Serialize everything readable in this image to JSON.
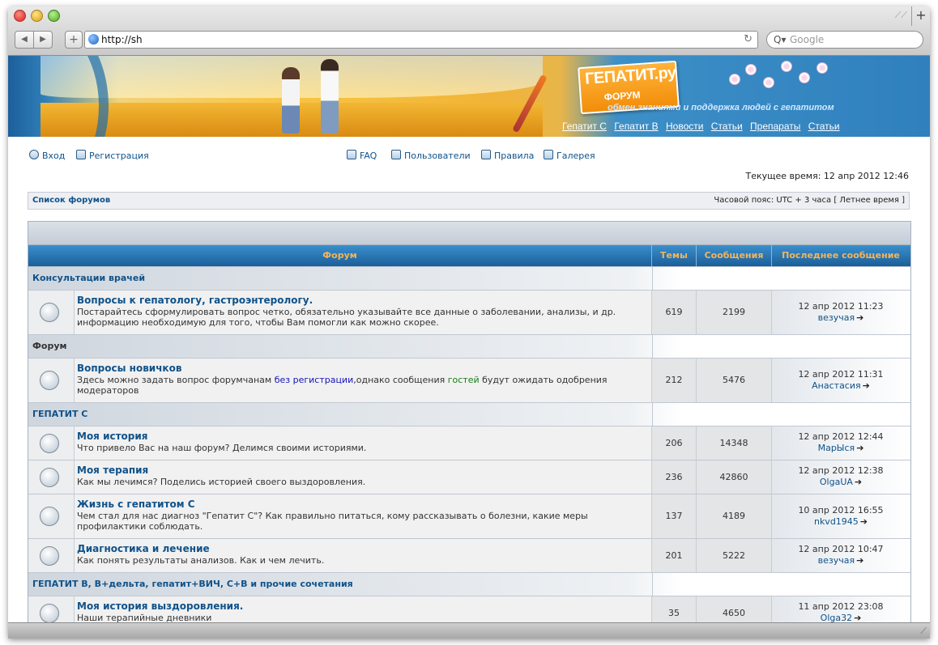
{
  "browser": {
    "url": "http://sh",
    "search_placeholder": "Google"
  },
  "banner": {
    "logo_title": "ГЕПАТИТ.ру",
    "logo_sub": "ФОРУМ",
    "tagline": "обмен знаниями и поддержка людей с гепатитом",
    "nav": [
      "Гепатит С",
      "Гепатит В",
      "Новости",
      "Статьи",
      "Препараты",
      "Статьи"
    ]
  },
  "toplinks": {
    "login": "Вход",
    "register": "Регистрация",
    "faq": "FAQ",
    "users": "Пользователи",
    "rules": "Правила",
    "gallery": "Галерея"
  },
  "current_time": "Текущее время: 12 апр 2012 12:46",
  "breadcrumb": {
    "label": "Список форумов",
    "timezone": "Часовой пояс: UTC + 3 часа [ Летнее время ]"
  },
  "table": {
    "headers": [
      "Форум",
      "Темы",
      "Сообщения",
      "Последнее сообщение"
    ],
    "categories": [
      {
        "name": "Консультации врачей",
        "forums": [
          {
            "title": "Вопросы к гепатологу, гастроэнтерологу.",
            "desc": "Постарайтесь сформулировать вопрос четко, обязательно указывайте все данные о заболевании, анализы, и др. информацию необходимую для того, чтобы Вам помогли как можно скорее.",
            "topics": "619",
            "posts": "2199",
            "last_date": "12 апр 2012 11:23",
            "last_user": "везучая"
          }
        ]
      },
      {
        "name": "Форум",
        "forums": [
          {
            "title": "Вопросы новичков",
            "desc_a": "Здесь можно задать вопрос форумчанам ",
            "desc_b": "без регистрации",
            "desc_c": ",однако сообщения ",
            "desc_d": "гостей",
            "desc_e": " будут ожидать одобрения модераторов",
            "topics": "212",
            "posts": "5476",
            "last_date": "12 апр 2012 11:31",
            "last_user": "Анастасия"
          }
        ]
      },
      {
        "name": "ГЕПАТИТ С",
        "forums": [
          {
            "title": "Моя история",
            "desc": "Что привело Вас на наш форум? Делимся своими историями.",
            "topics": "206",
            "posts": "14348",
            "last_date": "12 апр 2012 12:44",
            "last_user": "МарЫся"
          },
          {
            "title": "Моя терапия",
            "desc": "Как мы лечимся? Поделись историей своего выздоровления.",
            "topics": "236",
            "posts": "42860",
            "last_date": "12 апр 2012 12:38",
            "last_user": "OlgaUA"
          },
          {
            "title": "Жизнь с гепатитом С",
            "desc": "Чем стал для нас диагноз \"Гепатит С\"? Как правильно питаться, кому рассказывать о болезни, какие меры профилактики соблюдать.",
            "topics": "137",
            "posts": "4189",
            "last_date": "10 апр 2012 16:55",
            "last_user": "nkvd1945"
          },
          {
            "title": "Диагностика и лечение",
            "desc": "Как понять результаты анализов. Как и чем лечить.",
            "topics": "201",
            "posts": "5222",
            "last_date": "12 апр 2012 10:47",
            "last_user": "везучая"
          }
        ]
      },
      {
        "name": "ГЕПАТИТ B, B+дельта, гепатит+ВИЧ, C+B и прочие сочетания",
        "forums": [
          {
            "title": "Моя история выздоровления.",
            "desc": "Наши терапийные дневники",
            "topics": "35",
            "posts": "4650",
            "last_date": "11 апр 2012 23:08",
            "last_user": "Olga32"
          }
        ]
      }
    ]
  },
  "icons": {
    "forum": "forum-read-icon",
    "goto_last": "goto-last-post-icon"
  },
  "colors": {
    "header_bg": "#1a5f9a",
    "header_text": "#f3b45a",
    "link": "#105289"
  }
}
